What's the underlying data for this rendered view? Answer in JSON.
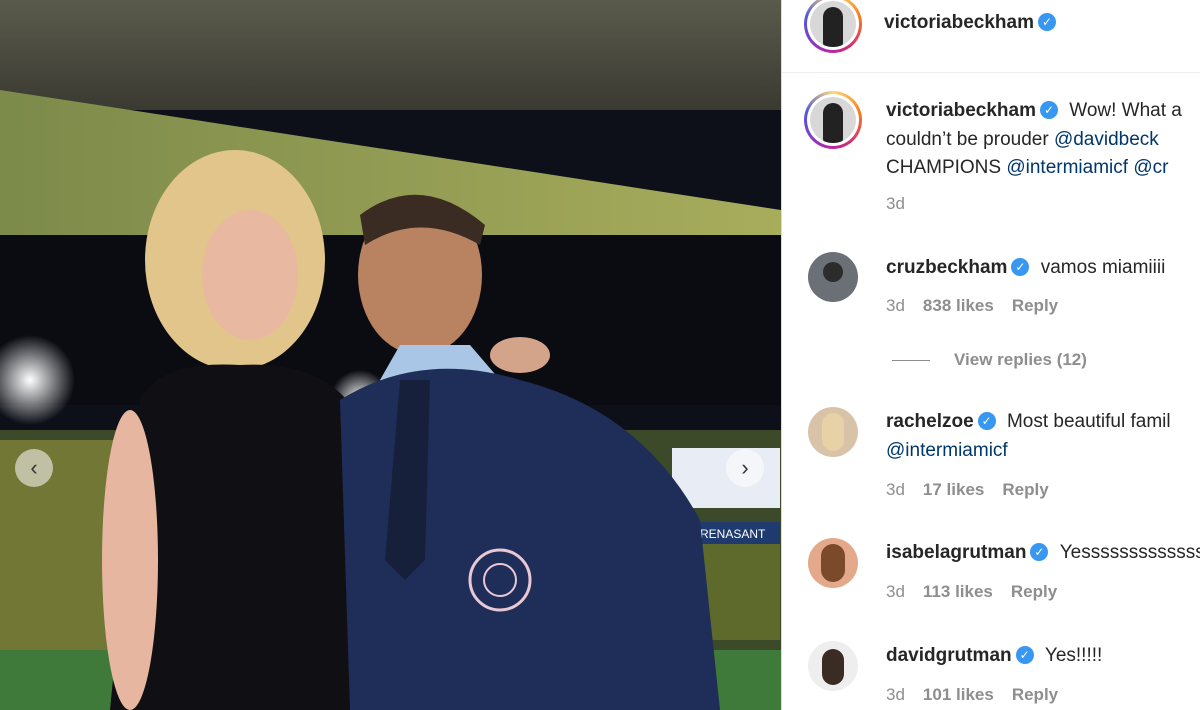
{
  "photo": {
    "prev_icon": "chevron-left",
    "next_icon": "chevron-right",
    "sign_text": "RENASANT"
  },
  "post": {
    "author": "victoriabeckham",
    "caption_line1": "Wow! What a",
    "caption_line2_pre": "couldn’t be prouder",
    "caption_line2_mention": "@davidbeck",
    "caption_line3_pre": "CHAMPIONS",
    "caption_line3_mention1": "@intermiamicf",
    "caption_line3_mention2": "@cr",
    "time": "3d"
  },
  "comments": [
    {
      "user": "cruzbeckham",
      "text": "vamos miamiiii",
      "time": "3d",
      "likes": "838 likes",
      "reply": "Reply"
    },
    {
      "user": "rachelzoe",
      "text": "Most beautiful famil",
      "text2_mention": "@intermiamicf",
      "time": "3d",
      "likes": "17 likes",
      "reply": "Reply"
    },
    {
      "user": "isabelagrutman",
      "text": "Yesssssssssssss",
      "time": "3d",
      "likes": "113 likes",
      "reply": "Reply"
    },
    {
      "user": "davidgrutman",
      "text": "Yes!!!!!",
      "time": "3d",
      "likes": "101 likes",
      "reply": "Reply"
    }
  ],
  "view_replies": "View replies (12)",
  "colors": {
    "verified": "#3897f0",
    "mention": "#00376b",
    "meta": "#8e8e8e"
  }
}
